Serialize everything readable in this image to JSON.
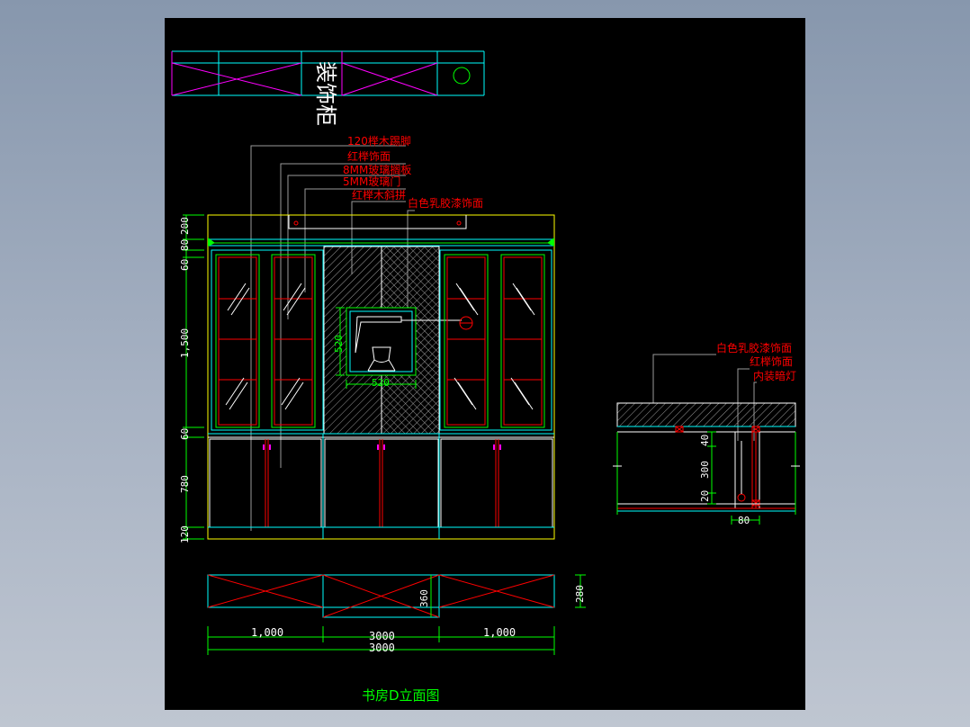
{
  "drawing": {
    "cabinet_title": "装饰柜",
    "title": "书房D立面图",
    "callouts_main": [
      "120榉木踢脚",
      "红榉饰面",
      "8MM玻璃搁板",
      "5MM玻璃门",
      "红榉木斜拼",
      "白色乳胶漆饰面"
    ],
    "callouts_section": [
      "白色乳胶漆饰面",
      "红榉饰面",
      "内装暗灯"
    ],
    "vertical_dims": [
      "200",
      "80",
      "60",
      "1,500",
      "60",
      "780",
      "120"
    ],
    "niche_dims": {
      "height": "520",
      "width": "520"
    },
    "plan_dims": {
      "depth": "360",
      "side": "280"
    },
    "bottom_dims": {
      "left": "1,000",
      "middle": "3000",
      "right": "1,000",
      "total": "3000"
    },
    "section_dims": {
      "top": "40",
      "mid": "300",
      "bottom": "20",
      "width": "80"
    }
  },
  "colors": {
    "background": "#000000",
    "frame": "#ffff00",
    "cyan": "#00ffff",
    "red": "#ff0000",
    "green": "#00ff00",
    "magenta": "#ff00ff",
    "white": "#ffffff",
    "gray": "#9a9a9a"
  }
}
